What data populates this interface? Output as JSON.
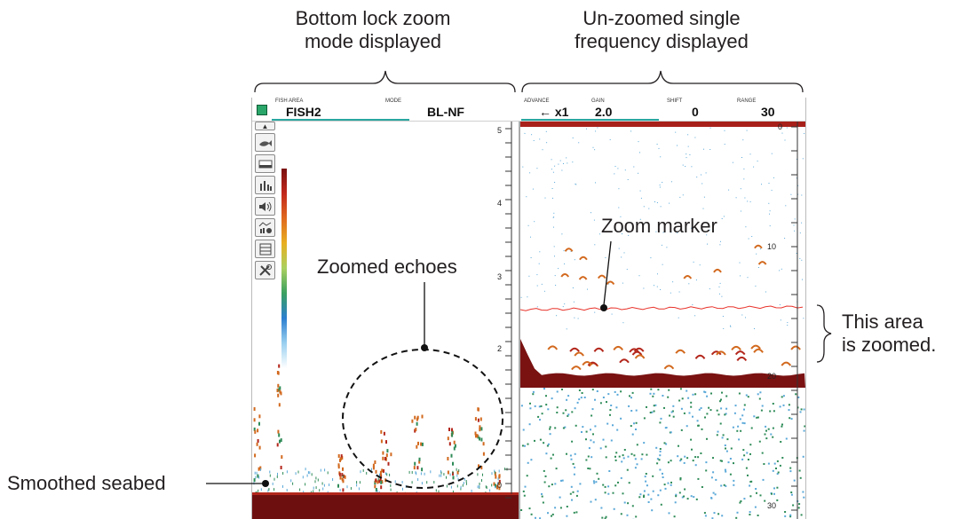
{
  "callouts": {
    "left_title_line1": "Bottom lock zoom",
    "left_title_line2": "mode displayed",
    "right_title_line1": "Un-zoomed single",
    "right_title_line2": "frequency displayed",
    "zoomed_echoes": "Zoomed echoes",
    "zoom_marker": "Zoom marker",
    "zoomed_area_line1": "This area",
    "zoomed_area_line2": "is zoomed.",
    "smoothed_seabed": "Smoothed seabed"
  },
  "header": {
    "fish_area_label": "FISH AREA",
    "fish_area_value": "FISH2",
    "mode_label": "MODE",
    "mode_value": "BL-NF",
    "advance_label": "ADVANCE",
    "advance_value": "← x1",
    "gain_label": "GAIN",
    "gain_value": "2.0",
    "shift_label": "SHIFT",
    "shift_value": "0",
    "range_label": "RANGE",
    "range_value": "30"
  },
  "toolbar": {
    "icons": [
      "up-arrow-icon",
      "fish-icon",
      "bottom-icon",
      "bars-icon",
      "speaker-icon",
      "stats-icon",
      "film-icon",
      "tools-icon"
    ],
    "up_glyph": "▲"
  },
  "left_scale": {
    "labels": [
      "5",
      "4",
      "3",
      "2",
      "0"
    ]
  },
  "right_scale": {
    "labels": [
      "0",
      "10",
      "20",
      "30"
    ]
  },
  "colors": {
    "seabed_dark": "#6e0f0f",
    "seabed_red": "#b3261b",
    "echo_orange": "#d2691e",
    "echo_green": "#2e8b57",
    "noise_blue": "#5aa8d8",
    "zoom_marker": "#e8322a",
    "header_accent": "#2aa7a0"
  }
}
